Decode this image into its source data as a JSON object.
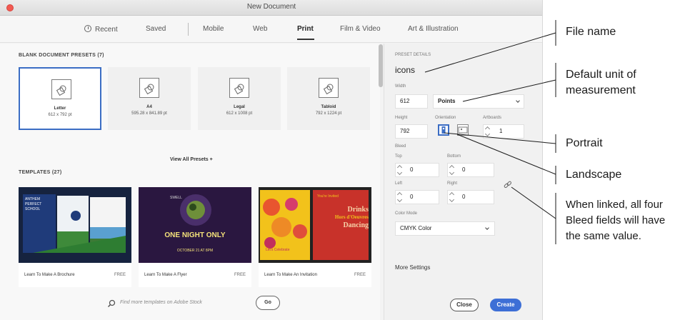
{
  "window": {
    "title": "New Document"
  },
  "tabs": [
    {
      "label": "Recent",
      "icon": "clock-icon"
    },
    {
      "label": "Saved"
    },
    {
      "label": "Mobile"
    },
    {
      "label": "Web"
    },
    {
      "label": "Print",
      "active": true
    },
    {
      "label": "Film & Video"
    },
    {
      "label": "Art & Illustration"
    }
  ],
  "blank_presets": {
    "heading": "BLANK DOCUMENT PRESETS  (7)",
    "items": [
      {
        "name": "Letter",
        "size": "612 x 792 pt",
        "selected": true
      },
      {
        "name": "A4",
        "size": "595.28 x 841.89 pt"
      },
      {
        "name": "Legal",
        "size": "612 x 1008 pt"
      },
      {
        "name": "Tabloid",
        "size": "792 x 1224 pt"
      }
    ],
    "view_all": "View All Presets +"
  },
  "templates": {
    "heading": "TEMPLATES  (27)",
    "items": [
      {
        "caption": "Learn To Make A Brochure",
        "badge": "FREE",
        "img_text": [
          "ANTHEM",
          "PERFECT",
          "SCHOOL"
        ]
      },
      {
        "caption": "Learn To Make A Flyer",
        "badge": "FREE",
        "img_text": [
          "SWELL",
          "ONE NIGHT ONLY",
          "OCTOBER 21 AT 8PM"
        ]
      },
      {
        "caption": "Learn To Make An Invitation",
        "badge": "FREE",
        "img_text": [
          "You're Invited",
          "Drinks",
          "Hors d'Oeuvres",
          "Dancing",
          "Let's Celebrate"
        ]
      }
    ]
  },
  "search": {
    "placeholder": "Find more templates on Adobe Stock",
    "go": "Go"
  },
  "preset_details": {
    "heading": "PRESET DETAILS",
    "name": "icons",
    "width_label": "Width",
    "width": "612",
    "units": "Points",
    "height_label": "Height",
    "height": "792",
    "orientation_label": "Orientation",
    "artboards_label": "Artboards",
    "artboards": "1",
    "bleed_label": "Bleed",
    "top_label": "Top",
    "top": "0",
    "bottom_label": "Bottom",
    "bottom": "0",
    "left_label": "Left",
    "left": "0",
    "right_label": "Right",
    "right": "0",
    "color_mode_label": "Color Mode",
    "color_mode": "CMYK Color",
    "more_settings": "More Settings",
    "close": "Close",
    "create": "Create"
  },
  "callouts": {
    "file_name": "File name",
    "default_unit": "Default unit of\nmeasurement",
    "portrait": "Portrait",
    "landscape": "Landscape",
    "linked": "When linked, all four\nBleed fields will have\nthe same value."
  },
  "colors": {
    "accent": "#3d6fd6",
    "selection": "#3b6dc4"
  }
}
